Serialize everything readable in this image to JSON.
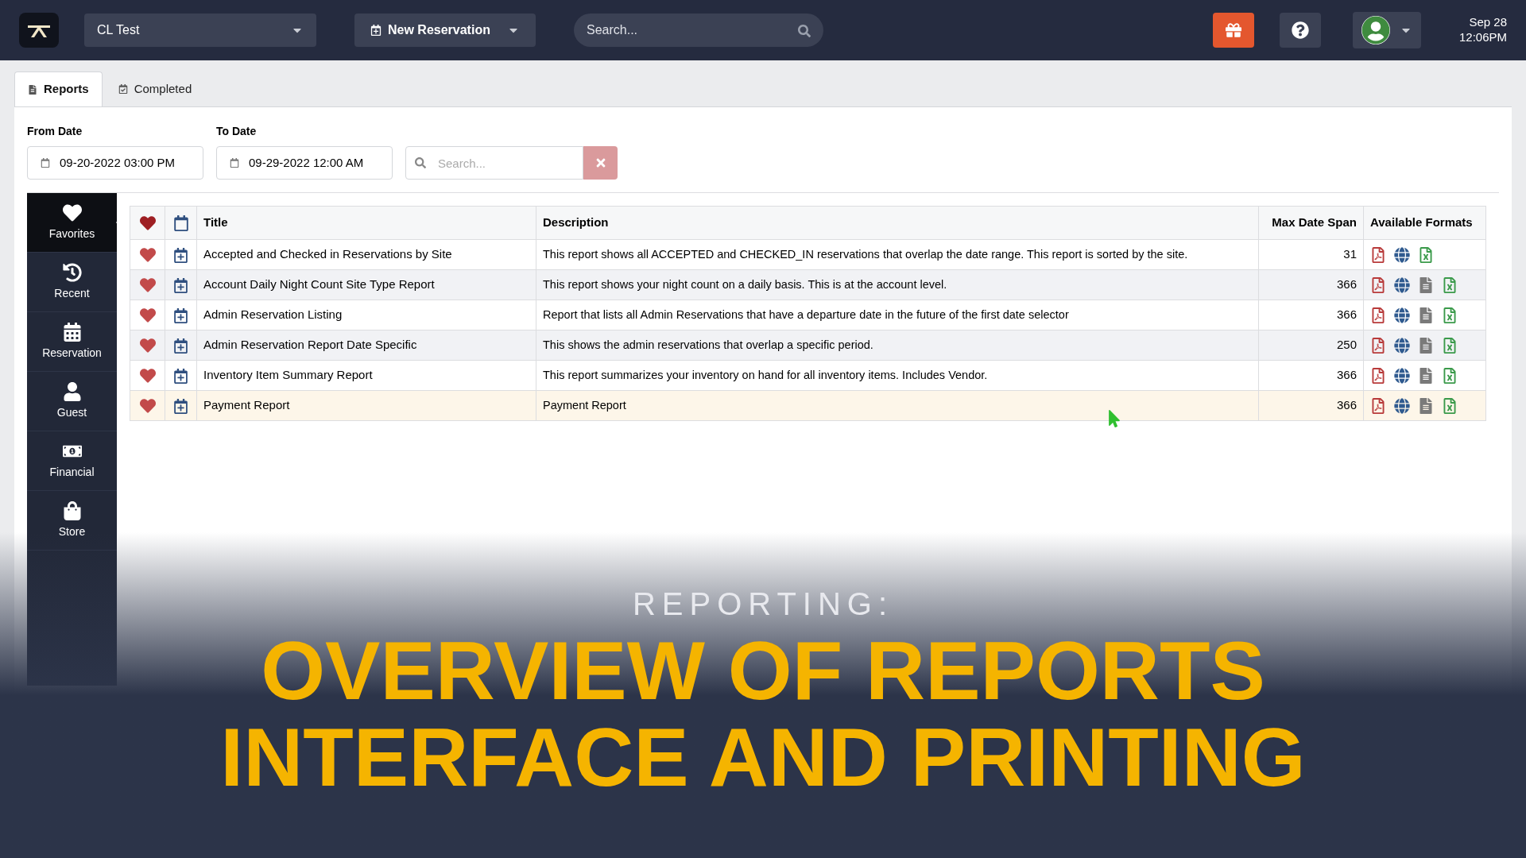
{
  "header": {
    "site": "CL Test",
    "new_button": "New Reservation",
    "search": {
      "placeholder": "Search..."
    },
    "date": "Sep 28",
    "time": "12:06PM"
  },
  "tabs": [
    {
      "label": "Reports",
      "kind": "reports",
      "selected": true
    },
    {
      "label": "Completed",
      "kind": "completed",
      "selected": false
    }
  ],
  "filters": {
    "from_label": "From Date",
    "from_value": "09-20-2022 03:00 PM",
    "to_label": "To Date",
    "to_value": "09-29-2022 12:00 AM",
    "search": {
      "placeholder": "Search..."
    }
  },
  "sidebar": {
    "items": [
      {
        "label": "Favorites",
        "kind": "favorites",
        "selected": true
      },
      {
        "label": "Recent",
        "kind": "recent",
        "selected": false
      },
      {
        "label": "Reservation",
        "kind": "reservation",
        "selected": false
      },
      {
        "label": "Guest",
        "kind": "guest",
        "selected": false
      },
      {
        "label": "Financial",
        "kind": "financial",
        "selected": false
      },
      {
        "label": "Store",
        "kind": "store",
        "selected": false
      }
    ]
  },
  "table": {
    "columns": [
      "Title",
      "Description",
      "Max Date Span",
      "Available Formats"
    ],
    "rows": [
      {
        "favorite": true,
        "selected": false,
        "title": "Accepted and Checked in Reservations by Site",
        "description": "This report shows all ACCEPTED and CHECKED_IN reservations that overlap the date range. This report is sorted by the site.",
        "max_span": "31",
        "formats": [
          {
            "kind": "pdf"
          },
          {
            "kind": "web"
          },
          {
            "kind": "excel"
          }
        ]
      },
      {
        "favorite": true,
        "selected": false,
        "title": "Account Daily Night Count Site Type Report",
        "description": "This report shows your night count on a daily basis. This is at the account level.",
        "max_span": "366",
        "formats": [
          {
            "kind": "pdf"
          },
          {
            "kind": "web"
          },
          {
            "kind": "text"
          },
          {
            "kind": "excel"
          }
        ]
      },
      {
        "favorite": true,
        "selected": false,
        "title": "Admin Reservation Listing",
        "description": "Report that lists all Admin Reservations that have a departure date in the future of the first date selector",
        "max_span": "366",
        "formats": [
          {
            "kind": "pdf"
          },
          {
            "kind": "web"
          },
          {
            "kind": "text"
          },
          {
            "kind": "excel"
          }
        ]
      },
      {
        "favorite": true,
        "selected": false,
        "title": "Admin Reservation Report Date Specific",
        "description": "This shows the admin reservations that overlap a specific period.",
        "max_span": "250",
        "formats": [
          {
            "kind": "pdf"
          },
          {
            "kind": "web"
          },
          {
            "kind": "text"
          },
          {
            "kind": "excel"
          }
        ]
      },
      {
        "favorite": true,
        "selected": false,
        "title": "Inventory Item Summary Report",
        "description": "This report summarizes your inventory on hand for all inventory items. Includes Vendor.",
        "max_span": "366",
        "formats": [
          {
            "kind": "pdf"
          },
          {
            "kind": "web"
          },
          {
            "kind": "text"
          },
          {
            "kind": "excel"
          }
        ]
      },
      {
        "favorite": true,
        "selected": true,
        "title": "Payment Report",
        "description": "Payment Report",
        "max_span": "366",
        "formats": [
          {
            "kind": "pdf"
          },
          {
            "kind": "web"
          },
          {
            "kind": "text"
          },
          {
            "kind": "excel"
          }
        ]
      }
    ]
  },
  "banner": {
    "kicker": "REPORTING:",
    "lines": [
      "OVERVIEW OF REPORTS",
      "INTERFACE AND PRINTING"
    ]
  }
}
